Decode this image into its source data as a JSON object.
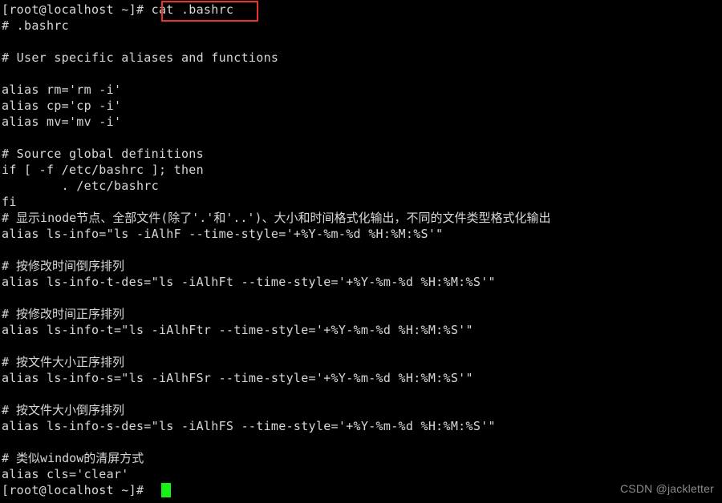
{
  "terminal": {
    "background_color": "#000000",
    "text_color": "#d8d8d8",
    "cursor_color": "#16f416",
    "highlight_box_color": "#e8352b",
    "prompt": "[root@localhost ~]#",
    "command": "cat .bashrc",
    "lines": [
      {
        "id": "line-prompt-command",
        "text": "[root@localhost ~]# cat .bashrc"
      },
      {
        "id": "line-header-comment",
        "text": "# .bashrc"
      },
      {
        "id": "line-blank-1",
        "text": ""
      },
      {
        "id": "line-user-specific",
        "text": "# User specific aliases and functions"
      },
      {
        "id": "line-blank-2",
        "text": ""
      },
      {
        "id": "line-alias-rm",
        "text": "alias rm='rm -i'"
      },
      {
        "id": "line-alias-cp",
        "text": "alias cp='cp -i'"
      },
      {
        "id": "line-alias-mv",
        "text": "alias mv='mv -i'"
      },
      {
        "id": "line-blank-3",
        "text": ""
      },
      {
        "id": "line-source-global",
        "text": "# Source global definitions"
      },
      {
        "id": "line-if-test",
        "text": "if [ -f /etc/bashrc ]; then"
      },
      {
        "id": "line-source-bashrc",
        "text": "        . /etc/bashrc"
      },
      {
        "id": "line-fi",
        "text": "fi"
      },
      {
        "id": "line-comment-inode",
        "text": "# 显示inode节点、全部文件(除了'.'和'..')、大小和时间格式化输出，不同的文件类型格式化输出",
        "cjk": true
      },
      {
        "id": "line-alias-ls-info",
        "text": "alias ls-info=\"ls -iAlhF --time-style='+%Y-%m-%d %H:%M:%S'\""
      },
      {
        "id": "line-blank-4",
        "text": ""
      },
      {
        "id": "line-comment-time-desc",
        "text": "# 按修改时间倒序排列",
        "cjk": true
      },
      {
        "id": "line-alias-ls-info-t-des",
        "text": "alias ls-info-t-des=\"ls -iAlhFt --time-style='+%Y-%m-%d %H:%M:%S'\""
      },
      {
        "id": "line-blank-5",
        "text": ""
      },
      {
        "id": "line-comment-time-asc",
        "text": "# 按修改时间正序排列",
        "cjk": true
      },
      {
        "id": "line-alias-ls-info-t",
        "text": "alias ls-info-t=\"ls -iAlhFtr --time-style='+%Y-%m-%d %H:%M:%S'\""
      },
      {
        "id": "line-blank-6",
        "text": ""
      },
      {
        "id": "line-comment-size-asc",
        "text": "# 按文件大小正序排列",
        "cjk": true
      },
      {
        "id": "line-alias-ls-info-s",
        "text": "alias ls-info-s=\"ls -iAlhFSr --time-style='+%Y-%m-%d %H:%M:%S'\""
      },
      {
        "id": "line-blank-7",
        "text": ""
      },
      {
        "id": "line-comment-size-desc",
        "text": "# 按文件大小倒序排列",
        "cjk": true
      },
      {
        "id": "line-alias-ls-info-s-des",
        "text": "alias ls-info-s-des=\"ls -iAlhFS --time-style='+%Y-%m-%d %H:%M:%S'\""
      },
      {
        "id": "line-blank-8",
        "text": ""
      },
      {
        "id": "line-comment-cls",
        "text": "# 类似window的清屏方式",
        "cjk": true
      },
      {
        "id": "line-alias-cls",
        "text": "alias cls='clear'"
      },
      {
        "id": "line-final-prompt",
        "text": "[root@localhost ~]# "
      }
    ]
  },
  "watermark": {
    "text": "CSDN @jackletter"
  }
}
